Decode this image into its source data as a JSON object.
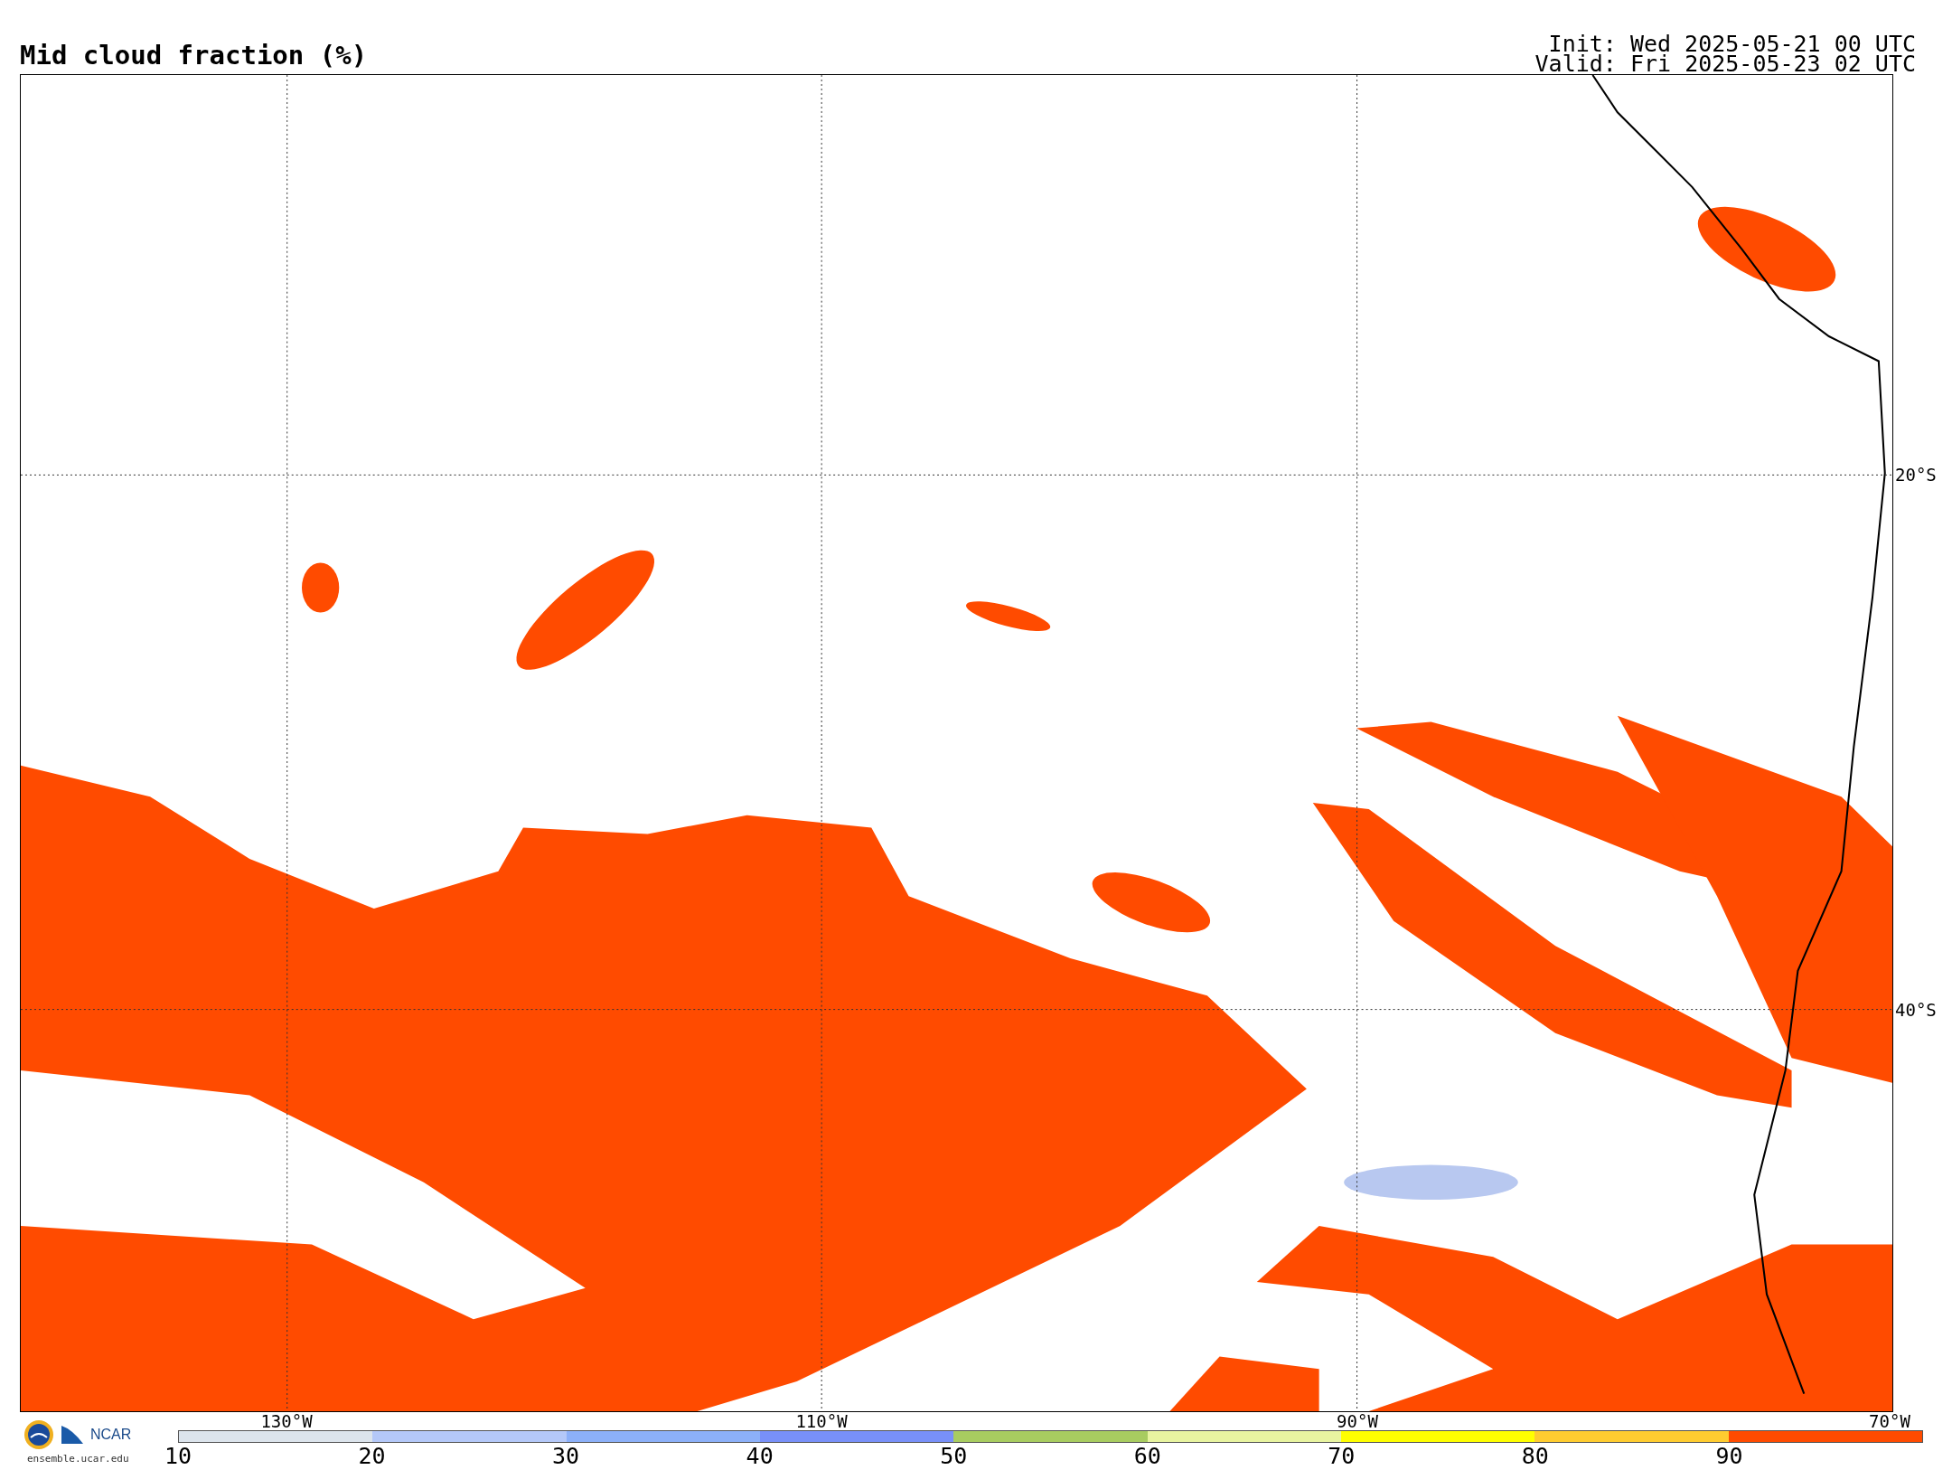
{
  "title": "Mid cloud fraction (%)",
  "init": "Init: Wed 2025-05-21 00 UTC",
  "valid": "Valid: Fri 2025-05-23 02 UTC",
  "map": {
    "lon_labels": [
      "130°W",
      "110°W",
      "90°W",
      "70°W"
    ],
    "lat_labels": [
      "20°S",
      "40°S"
    ]
  },
  "logo": {
    "name": "NCAR",
    "url": "ensemble.ucar.edu"
  },
  "colorbar": {
    "segments": [
      {
        "color": "#dce4ec"
      },
      {
        "color": "#b4c8f8"
      },
      {
        "color": "#8cb0f8"
      },
      {
        "color": "#7890f8"
      },
      {
        "color": "#a8cc60"
      },
      {
        "color": "#e8f4a0"
      },
      {
        "color": "#ffff00"
      },
      {
        "color": "#ffcc30"
      },
      {
        "color": "#ff4b00"
      }
    ],
    "labels": [
      "10",
      "20",
      "30",
      "40",
      "50",
      "60",
      "70",
      "80",
      "90"
    ]
  }
}
